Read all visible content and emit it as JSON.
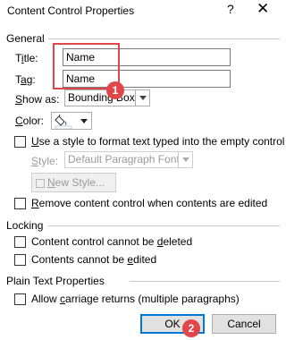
{
  "window": {
    "title": "Content Control Properties",
    "help": "?",
    "close": "✕"
  },
  "general": {
    "header": "General",
    "title_label_pre": "T",
    "title_label_u": "i",
    "title_label_post": "tle:",
    "title_value": "Name",
    "tag_label_pre": "T",
    "tag_label_u": "a",
    "tag_label_post": "g:",
    "tag_value": "Name",
    "show_as_label_pre": "",
    "show_as_label_u": "S",
    "show_as_label_post": "how as:",
    "show_as_value": "Bounding Box",
    "color_label_pre": "",
    "color_label_u": "C",
    "color_label_post": "olor:",
    "use_style_pre": "",
    "use_style_u": "U",
    "use_style_post": "se a style to format text typed into the empty control",
    "style_label_pre": "",
    "style_label_u": "S",
    "style_label_post": "tyle:",
    "style_value": "Default Paragraph Font",
    "new_style_pre": "",
    "new_style_u": "N",
    "new_style_post": "ew Style...",
    "remove_pre": "",
    "remove_u": "R",
    "remove_post": "emove content control when contents are edited"
  },
  "locking": {
    "header": "Locking",
    "cannot_delete_pre": "Content control cannot be ",
    "cannot_delete_u": "d",
    "cannot_delete_post": "eleted",
    "cannot_edit_pre": "Contents cannot be ",
    "cannot_edit_u": "e",
    "cannot_edit_post": "dited"
  },
  "plain_text": {
    "header": "Plain Text Properties",
    "allow_pre": "Allow ",
    "allow_u": "c",
    "allow_post": "arriage returns (multiple paragraphs)"
  },
  "buttons": {
    "ok": "OK",
    "cancel": "Cancel"
  },
  "annotations": {
    "step1": "1",
    "step2": "2",
    "accent_color": "#e0464a"
  },
  "colors": {
    "focus_blue": "#0078d7"
  }
}
